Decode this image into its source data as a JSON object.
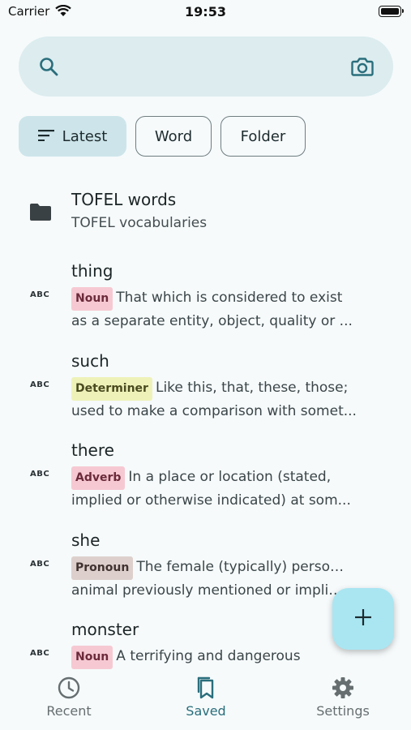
{
  "status_bar": {
    "carrier": "Carrier",
    "time": "19:53"
  },
  "search": {
    "value": "",
    "placeholder": ""
  },
  "filters": [
    {
      "label": "Latest",
      "active": true
    },
    {
      "label": "Word",
      "active": false
    },
    {
      "label": "Folder",
      "active": false
    }
  ],
  "folder": {
    "title": "TOFEL words",
    "subtitle": "TOFEL vocabularies",
    "icon": "folder-icon"
  },
  "abc_label": "ABC",
  "words": [
    {
      "word": "thing",
      "pos": "Noun",
      "pos_color": "#f6c9d2",
      "line1": "That which is considered to exist",
      "line2": "as a separate entity, object, quality or ..."
    },
    {
      "word": "such",
      "pos": "Determiner",
      "pos_color": "#eef2b8",
      "line1": "Like this, that, these, those;",
      "line2": "used to make a comparison with somet..."
    },
    {
      "word": "there",
      "pos": "Adverb",
      "pos_color": "#f6c9d2",
      "line1": "In a place or location (stated,",
      "line2": "implied or otherwise indicated) at som..."
    },
    {
      "word": "she",
      "pos": "Pronoun",
      "pos_color": "#ddd0cc",
      "line1": "The female (typically) person or",
      "line2": "animal previously mentioned or implied..."
    },
    {
      "word": "monster",
      "pos": "Noun",
      "pos_color": "#f6c9d2",
      "line1": "A terrifying and dangerous",
      "line2": ""
    }
  ],
  "fab": {
    "icon": "plus-icon"
  },
  "nav": [
    {
      "label": "Recent",
      "icon": "clock-icon",
      "active": false
    },
    {
      "label": "Saved",
      "icon": "bookmarks-icon",
      "active": true
    },
    {
      "label": "Settings",
      "icon": "gear-icon",
      "active": false
    }
  ],
  "colors": {
    "accent": "#2a6e7c",
    "search_bg": "#dcecef",
    "chip_active": "#cde5ea",
    "fab": "#a9e6f2"
  }
}
